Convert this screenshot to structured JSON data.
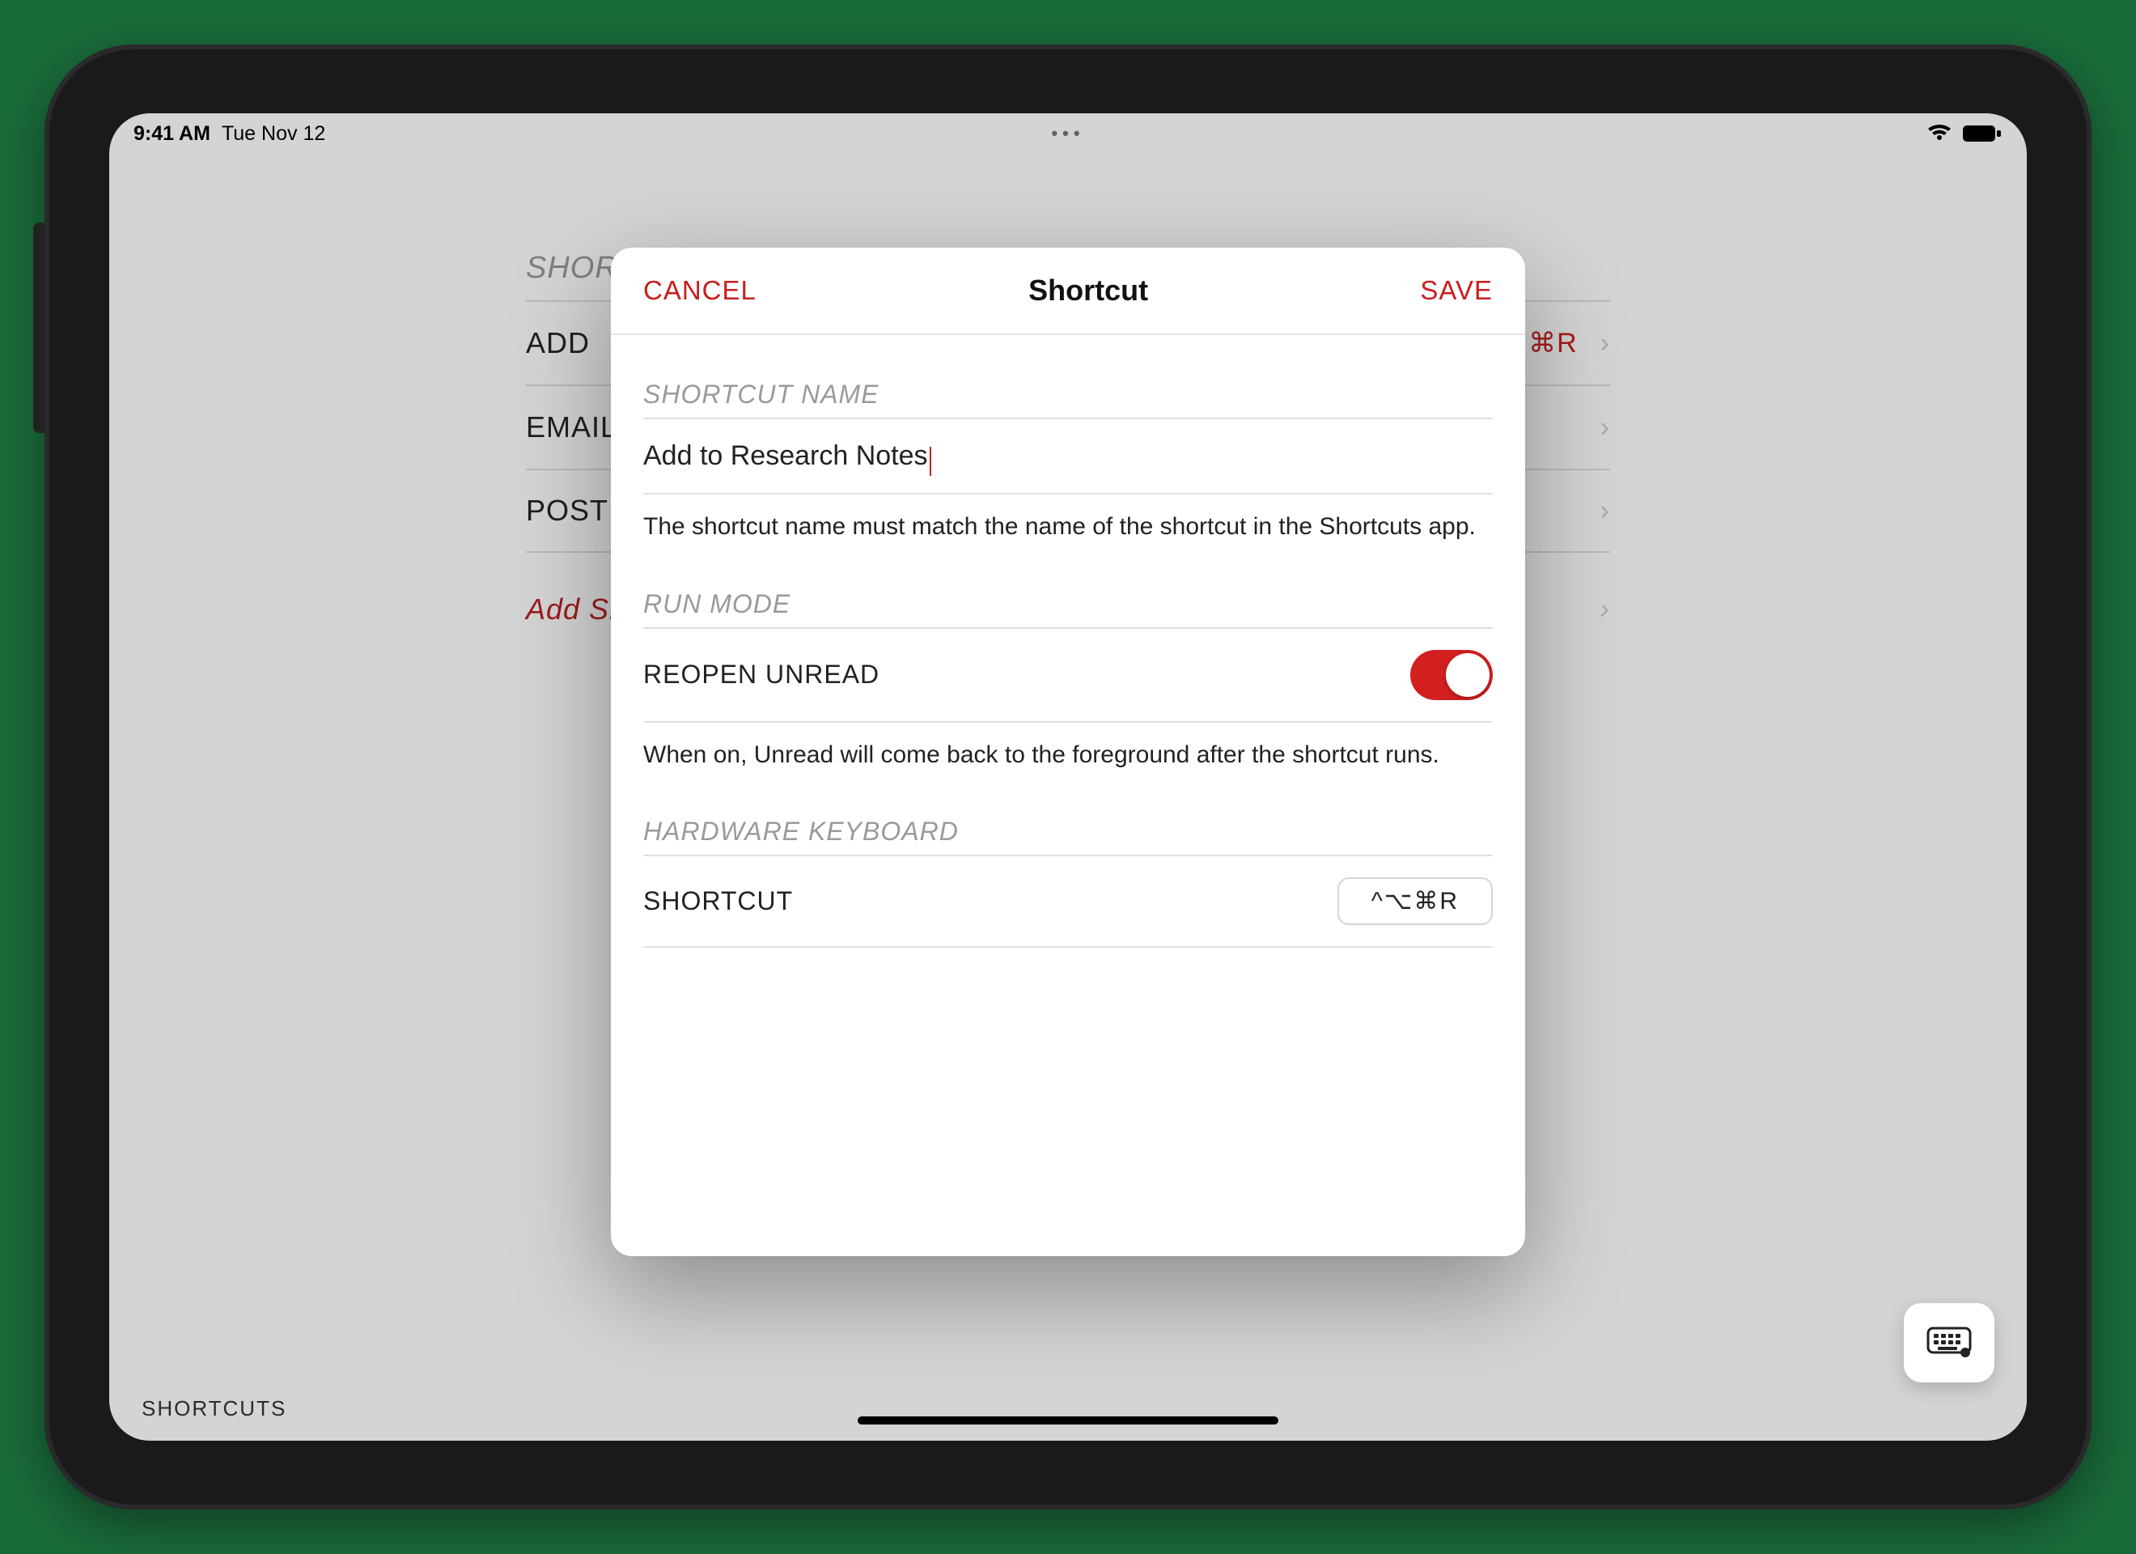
{
  "status": {
    "time": "9:41 AM",
    "date": "Tue Nov 12"
  },
  "bg": {
    "section": "SHORTCUTS",
    "rows": {
      "add": {
        "label": "ADD",
        "key": "⌘R"
      },
      "email": {
        "label": "EMAIL"
      },
      "post": {
        "label": "POST"
      }
    },
    "add_shortcut": "Add Shortcut…"
  },
  "modal": {
    "cancel": "CANCEL",
    "title": "Shortcut",
    "save": "SAVE",
    "name_section": "SHORTCUT NAME",
    "name_value": "Add to Research Notes",
    "name_help": "The shortcut name must match the name of the shortcut in the Shortcuts app.",
    "runmode_section": "RUN MODE",
    "reopen_label": "REOPEN UNREAD",
    "reopen_help": "When on, Unread will come back to the foreground after the shortcut runs.",
    "hw_section": "HARDWARE KEYBOARD",
    "hw_label": "SHORTCUT",
    "hw_value": "^⌥⌘R"
  },
  "footer": {
    "label": "SHORTCUTS"
  }
}
